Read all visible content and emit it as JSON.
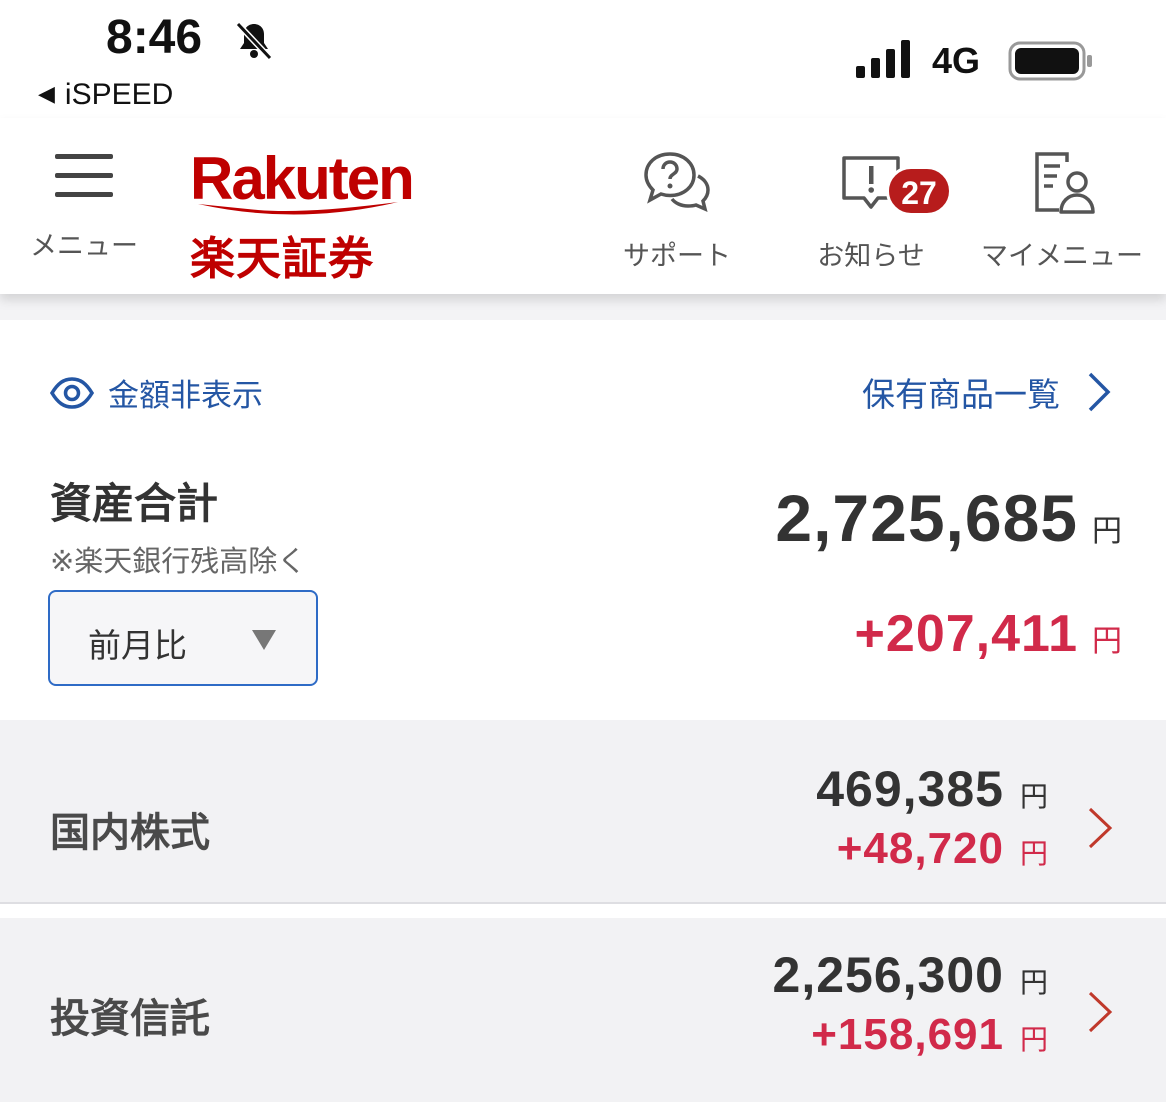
{
  "status_bar": {
    "time": "8:46",
    "back_app": "iSPEED",
    "network": "4G",
    "icons": [
      "bell-off-icon",
      "signal-icon",
      "battery-icon"
    ]
  },
  "header": {
    "menu_label": "メニュー",
    "logo_word": "Rakuten",
    "logo_jp": "楽天証券",
    "support_label": "サポート",
    "notice_label": "お知らせ",
    "notice_badge": "27",
    "mymenu_label": "マイメニュー"
  },
  "summary": {
    "hide_amount_label": "金額非表示",
    "holdings_link": "保有商品一覧",
    "total_title": "資産合計",
    "total_note": "※楽天銀行残高除く",
    "period_selected": "前月比",
    "total_amount": "2,725,685",
    "total_change": "+207,411",
    "currency": "円"
  },
  "categories": [
    {
      "name": "国内株式",
      "amount": "469,385",
      "change": "+48,720",
      "currency": "円"
    },
    {
      "name": "投資信託",
      "amount": "2,256,300",
      "change": "+158,691",
      "currency": "円"
    }
  ],
  "colors": {
    "brand_red": "#bf0000",
    "link_blue": "#2456a4",
    "gain_red": "#d12a4a",
    "badge_red": "#b71c1c",
    "row_bg": "#f2f2f4"
  }
}
